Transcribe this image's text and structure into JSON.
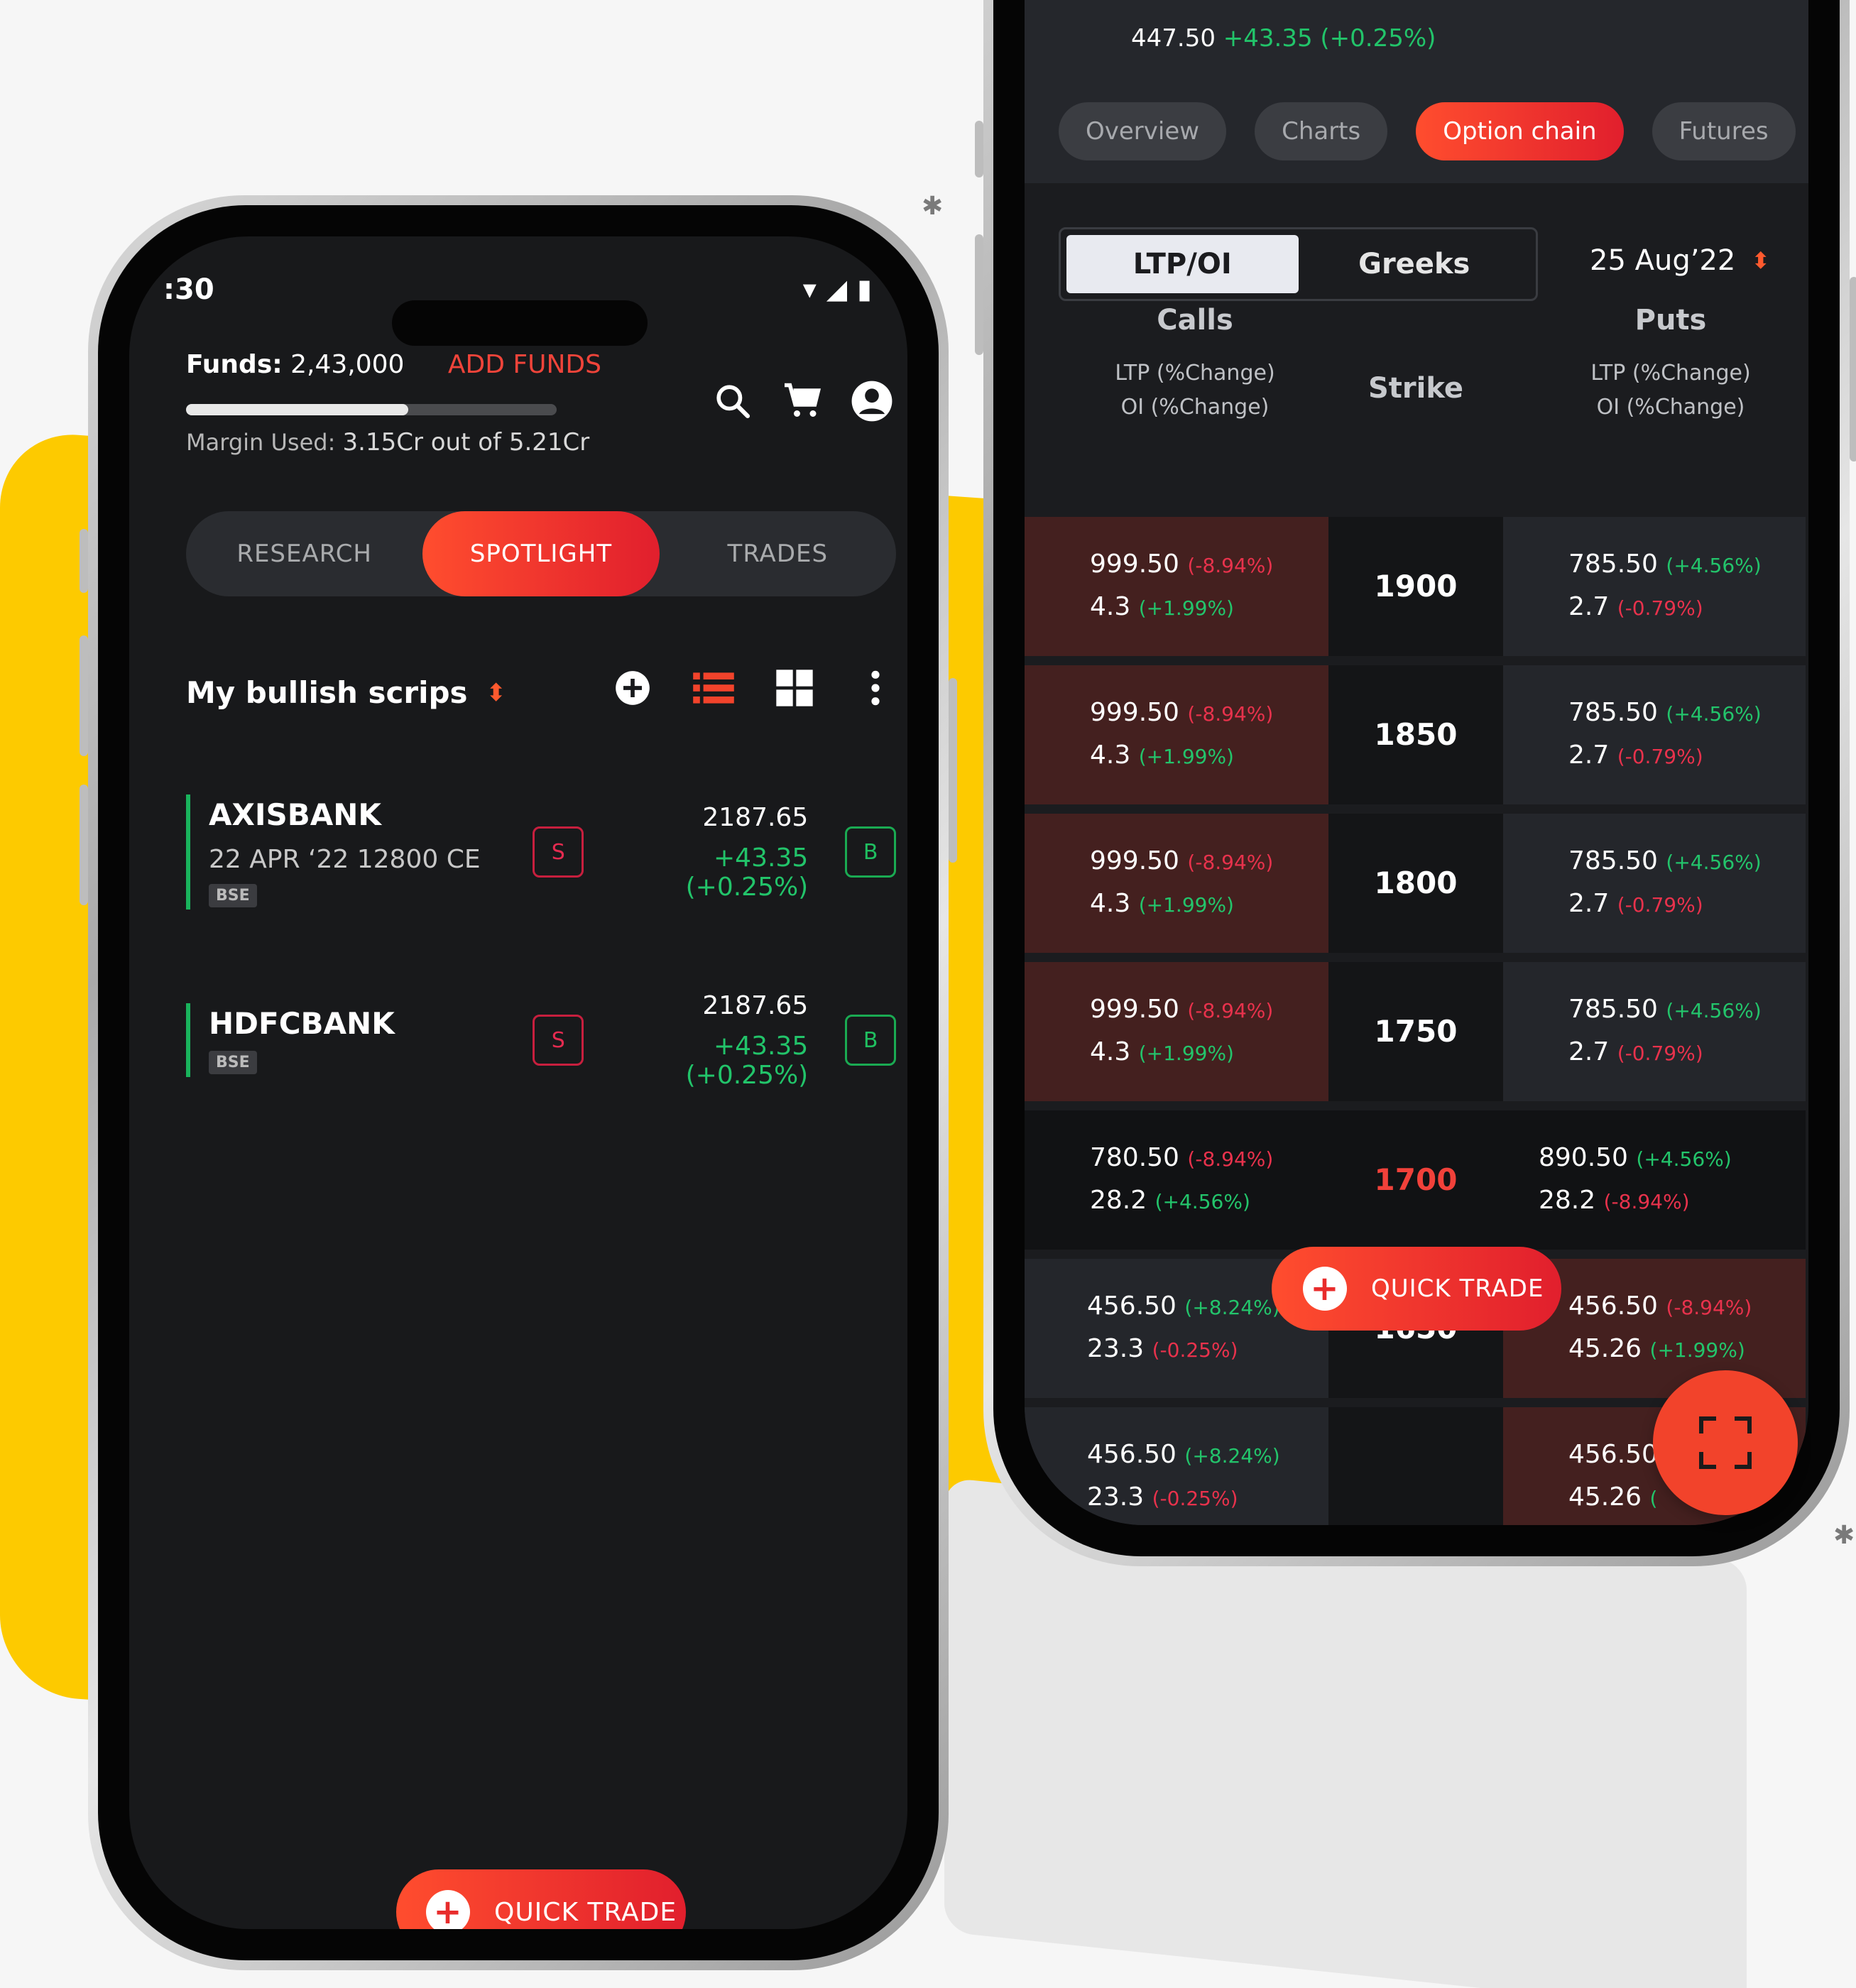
{
  "left_phone": {
    "status_time": ":30",
    "funds_label": "Funds:",
    "funds_value": "2,43,000",
    "add_funds": "ADD FUNDS",
    "margin_label": "Margin Used:",
    "margin_value": "3.15Cr out of 5.21Cr",
    "margin_used_fraction": 0.6,
    "header_icons": [
      "search-icon",
      "cart-icon",
      "account-icon"
    ],
    "tabs": [
      "RESEARCH",
      "SPOTLIGHT",
      "TRADES"
    ],
    "active_tab": "SPOTLIGHT",
    "section_title": "My bullish scrips",
    "section_icons": [
      "add-icon",
      "list-view-icon",
      "grid-view-icon",
      "more-icon"
    ],
    "scrips": [
      {
        "name": "AXISBANK",
        "sub": "22 APR ‘22 12800 CE",
        "exchange": "BSE",
        "sell": "S",
        "price": "2187.65",
        "change": "+43.35 (+0.25%)",
        "buy": "B"
      },
      {
        "name": "HDFCBANK",
        "sub": "",
        "exchange": "BSE",
        "sell": "S",
        "price": "2187.65",
        "change": "+43.35 (+0.25%)",
        "buy": "B"
      }
    ],
    "quick_trade": "QUICK TRADE"
  },
  "right_phone": {
    "top_price": "447.50",
    "top_change": "+43.35 (+0.25%)",
    "tabs": [
      "Overview",
      "Charts",
      "Option chain",
      "Futures"
    ],
    "active_tab": "Option chain",
    "segment": [
      "LTP/OI",
      "Greeks"
    ],
    "active_segment": "LTP/OI",
    "expiry": "25 Aug’22",
    "calls_title": "Calls",
    "puts_title": "Puts",
    "strike_title": "Strike",
    "calls_sub1": "LTP (%Change)",
    "calls_sub2": "OI (%Change)",
    "puts_sub1": "LTP (%Change)",
    "puts_sub2": "OI (%Change)",
    "rows": [
      {
        "call_ltp": "999.50",
        "call_ltp_chg": "(-8.94%)",
        "call_oi": "4.3",
        "call_oi_chg": "(+1.99%)",
        "strike": "1900",
        "put_ltp": "785.50",
        "put_ltp_chg": "(+4.56%)",
        "put_oi": "2.7",
        "put_oi_chg": "(-0.79%)"
      },
      {
        "call_ltp": "999.50",
        "call_ltp_chg": "(-8.94%)",
        "call_oi": "4.3",
        "call_oi_chg": "(+1.99%)",
        "strike": "1850",
        "put_ltp": "785.50",
        "put_ltp_chg": "(+4.56%)",
        "put_oi": "2.7",
        "put_oi_chg": "(-0.79%)"
      },
      {
        "call_ltp": "999.50",
        "call_ltp_chg": "(-8.94%)",
        "call_oi": "4.3",
        "call_oi_chg": "(+1.99%)",
        "strike": "1800",
        "put_ltp": "785.50",
        "put_ltp_chg": "(+4.56%)",
        "put_oi": "2.7",
        "put_oi_chg": "(-0.79%)"
      },
      {
        "call_ltp": "999.50",
        "call_ltp_chg": "(-8.94%)",
        "call_oi": "4.3",
        "call_oi_chg": "(+1.99%)",
        "strike": "1750",
        "put_ltp": "785.50",
        "put_ltp_chg": "(+4.56%)",
        "put_oi": "2.7",
        "put_oi_chg": "(-0.79%)"
      },
      {
        "call_ltp": "780.50",
        "call_ltp_chg": "(-8.94%)",
        "call_oi": "28.2",
        "call_oi_chg": "(+4.56%)",
        "strike": "1700",
        "put_ltp": "890.50",
        "put_ltp_chg": "(+4.56%)",
        "put_oi": "28.2",
        "put_oi_chg": "(-8.94%)"
      },
      {
        "call_ltp": "456.50",
        "call_ltp_chg": "(+8.24%)",
        "call_oi": "23.3",
        "call_oi_chg": "(-0.25%)",
        "strike": "1650",
        "put_ltp": "456.50",
        "put_ltp_chg": "(-8.94%)",
        "put_oi": "45.26",
        "put_oi_chg": "(+1.99%)"
      },
      {
        "call_ltp": "456.50",
        "call_ltp_chg": "(+8.24%)",
        "call_oi": "23.3",
        "call_oi_chg": "(-0.25%)",
        "strike": "",
        "put_ltp": "456.50",
        "put_ltp_chg": "",
        "put_oi": "45.26",
        "put_oi_chg": "("
      }
    ],
    "quick_trade": "QUICK TRADE",
    "fab_icon": "fullscreen-icon"
  },
  "colors": {
    "accent": "#f2432b",
    "yellow": "#fdca00",
    "positive": "#22c46a",
    "negative": "#e8324c",
    "screen_bg": "#18191b"
  }
}
